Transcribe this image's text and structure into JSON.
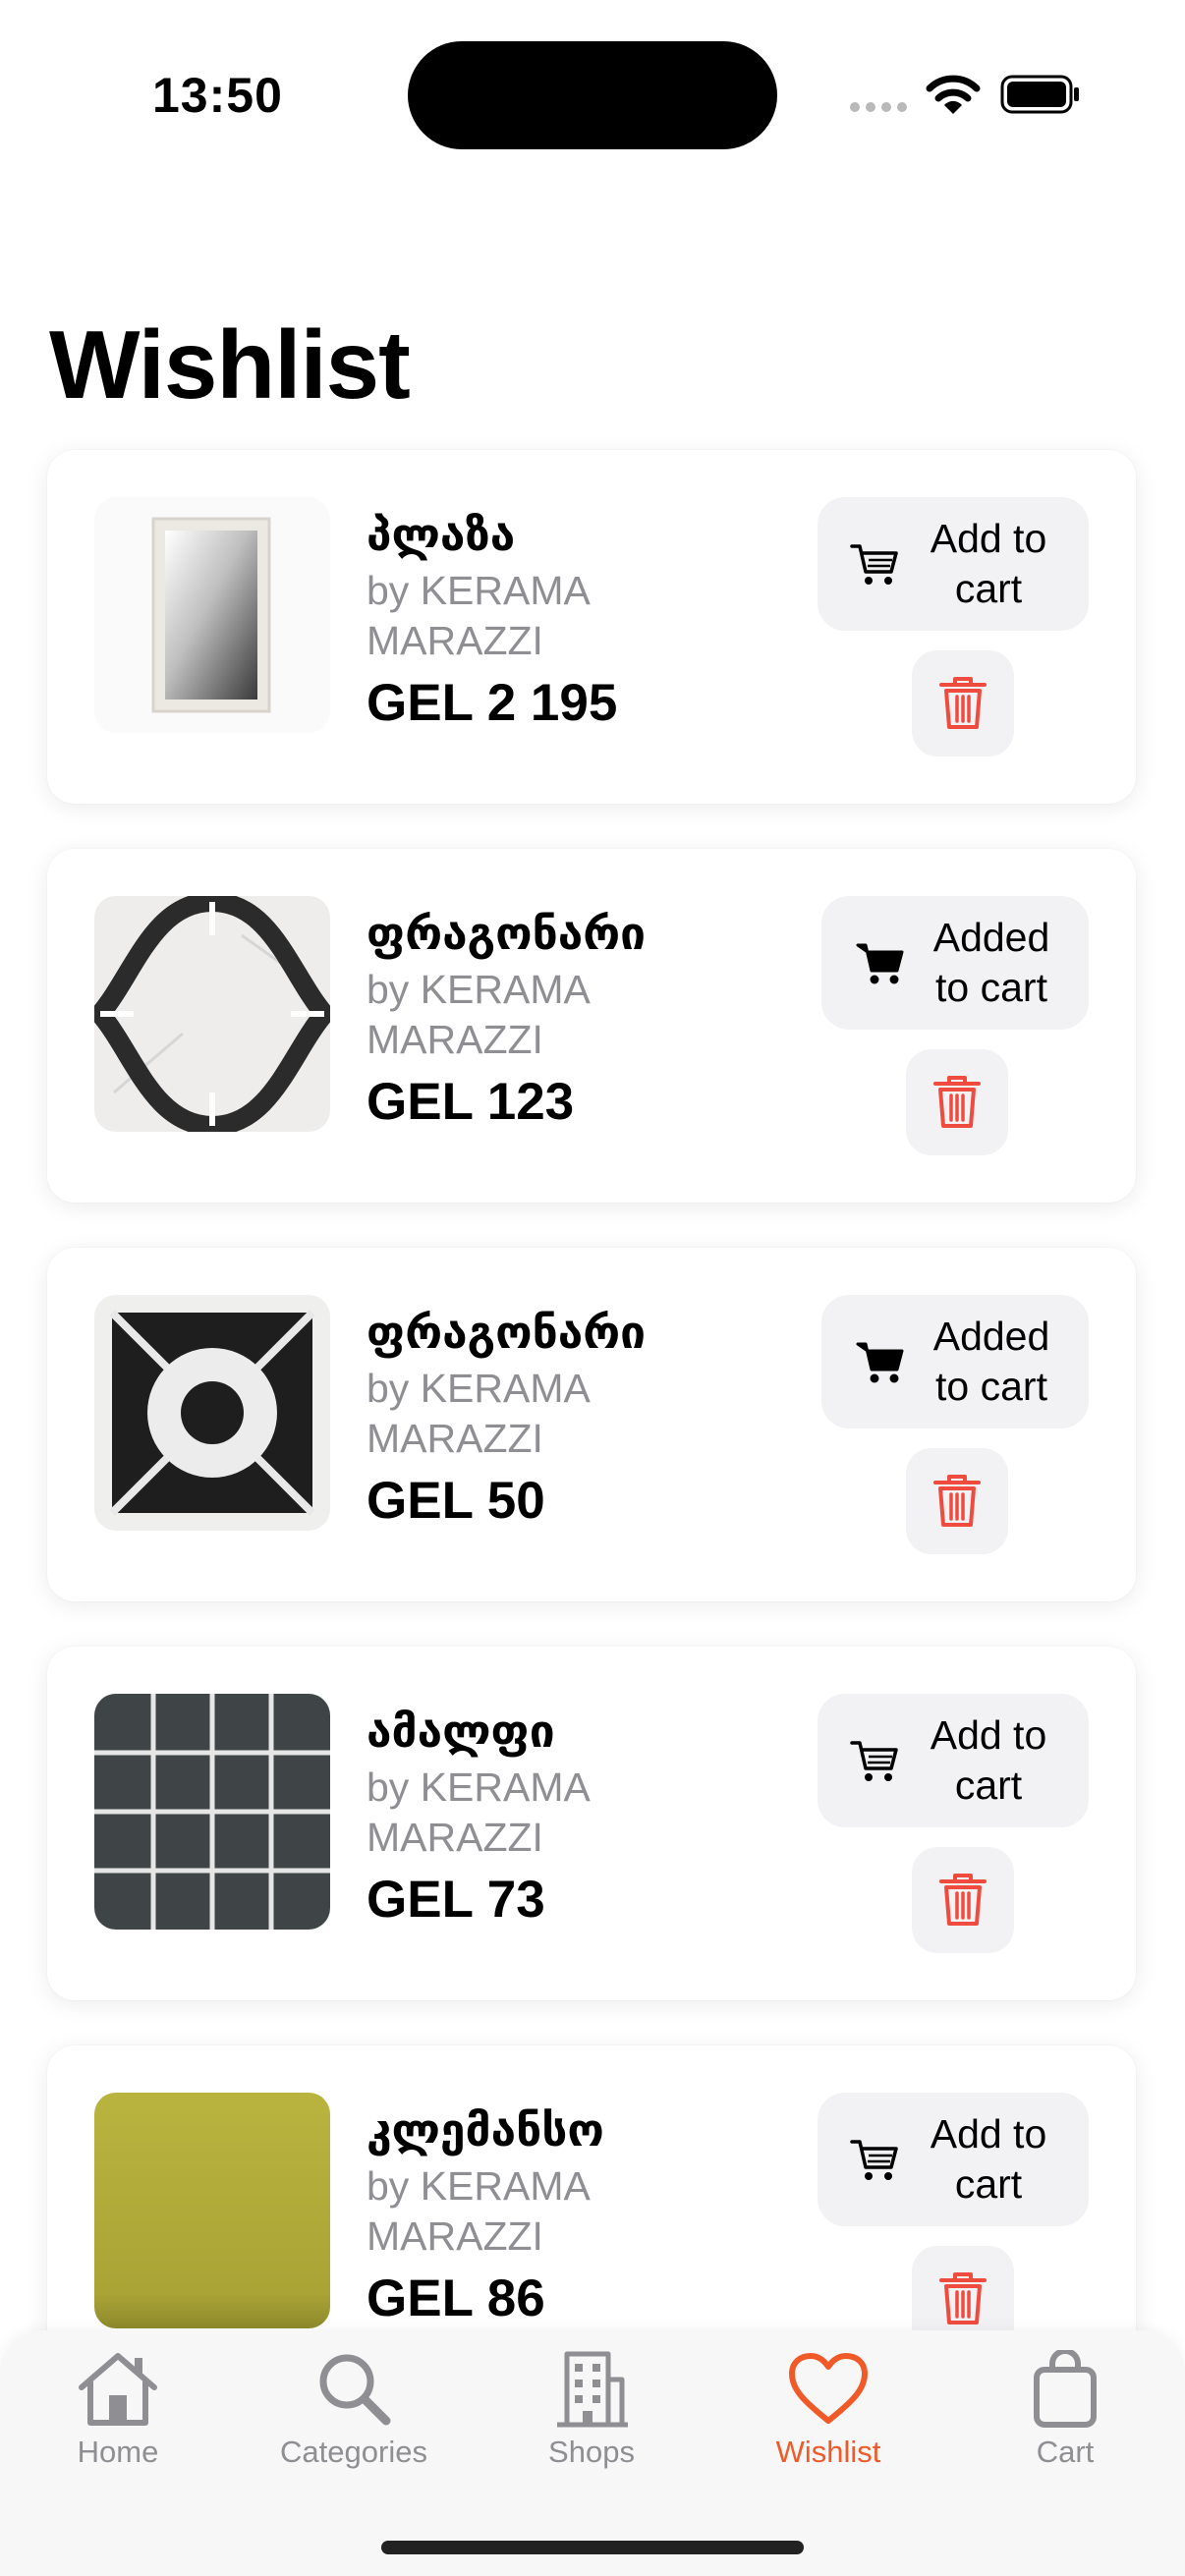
{
  "status_bar": {
    "time": "13:50"
  },
  "page": {
    "title": "Wishlist"
  },
  "colors": {
    "accent": "#f05a28",
    "delete": "#ef4b3f",
    "muted": "#8e8e93",
    "button_bg": "#f2f2f4"
  },
  "items": [
    {
      "name": "პლაზა",
      "brand": "by KERAMA MARAZZI",
      "price": "GEL 2 195",
      "cart_label": "Add to cart",
      "in_cart": false,
      "image": "mirror"
    },
    {
      "name": "ფრაგონარი",
      "brand": "by KERAMA MARAZZI",
      "price": "GEL 123",
      "cart_label": "Added to cart",
      "in_cart": true,
      "image": "arabesque-tile"
    },
    {
      "name": "ფრაგონარი",
      "brand": "by KERAMA MARAZZI",
      "price": "GEL 50",
      "cart_label": "Added to cart",
      "in_cart": true,
      "image": "ring-tile"
    },
    {
      "name": "ამალფი",
      "brand": "by KERAMA MARAZZI",
      "price": "GEL 73",
      "cart_label": "Add to cart",
      "in_cart": false,
      "image": "dark-grid-tile"
    },
    {
      "name": "კლემანსო",
      "brand": "by KERAMA MARAZZI",
      "price": "GEL 86",
      "cart_label": "Add to cart",
      "in_cart": false,
      "image": "olive-tile"
    }
  ],
  "tabs": [
    {
      "label": "Home",
      "icon": "house-icon",
      "active": false
    },
    {
      "label": "Categories",
      "icon": "search-icon",
      "active": false
    },
    {
      "label": "Shops",
      "icon": "building-icon",
      "active": false
    },
    {
      "label": "Wishlist",
      "icon": "heart-icon",
      "active": true
    },
    {
      "label": "Cart",
      "icon": "bag-icon",
      "active": false
    }
  ]
}
